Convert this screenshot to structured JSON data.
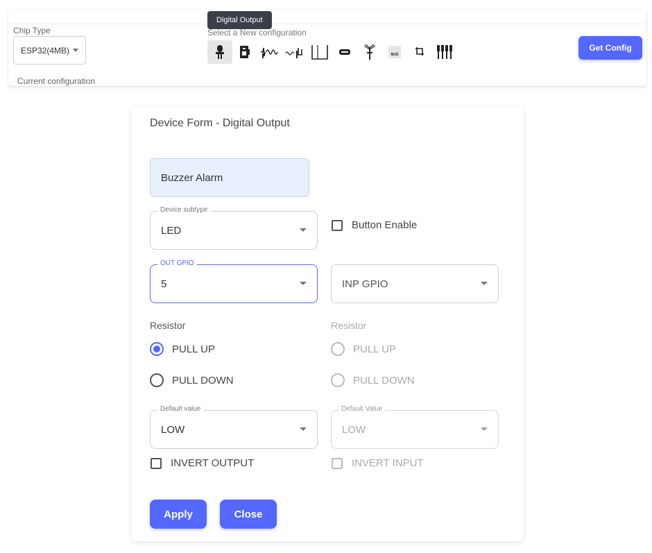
{
  "topbar": {
    "chip_type_label": "Chip Type",
    "chip_type_value": "ESP32(4MB)",
    "current_config_label": "Current configuration",
    "new_config_label": "Select a New configuration",
    "tooltip": "Digital Output",
    "config_icons": [
      "digital-output-icon",
      "relay-module-icon",
      "analog-wave-icon",
      "pwm-wave-icon",
      "pulse-icon",
      "ir-sensor-icon",
      "antenna-icon",
      "bus-module-icon",
      "i2c-connection-icon",
      "multi-pin-icon"
    ],
    "bus_icon_text": "BUS",
    "get_config_label": "Get Config"
  },
  "form": {
    "title": "Device Form - Digital Output",
    "device_name": "Buzzer Alarm",
    "device_subtype_label": "Device subtype",
    "device_subtype_value": "LED",
    "button_enable_label": "Button Enable",
    "out_gpio_label": "OUT GPIO",
    "out_gpio_value": "5",
    "inp_gpio_placeholder": "INP GPIO",
    "resistor_left_label": "Resistor",
    "resistor_right_label": "Resistor",
    "pull_up_label": "PULL UP",
    "pull_down_label": "PULL DOWN",
    "pull_up_label_right": "PULL UP",
    "pull_down_label_right": "PULL DOWN",
    "default_value_label": "Default value",
    "default_value_value": "LOW",
    "default_value_label_right": "Default Value",
    "default_value_value_right": "LOW",
    "invert_output_label": "INVERT OUTPUT",
    "invert_input_label": "INVERT INPUT",
    "apply_label": "Apply",
    "close_label": "Close"
  },
  "colors": {
    "accent": "#5468ff",
    "name_field_bg": "#e8effd",
    "tooltip_bg": "#3b4048"
  }
}
